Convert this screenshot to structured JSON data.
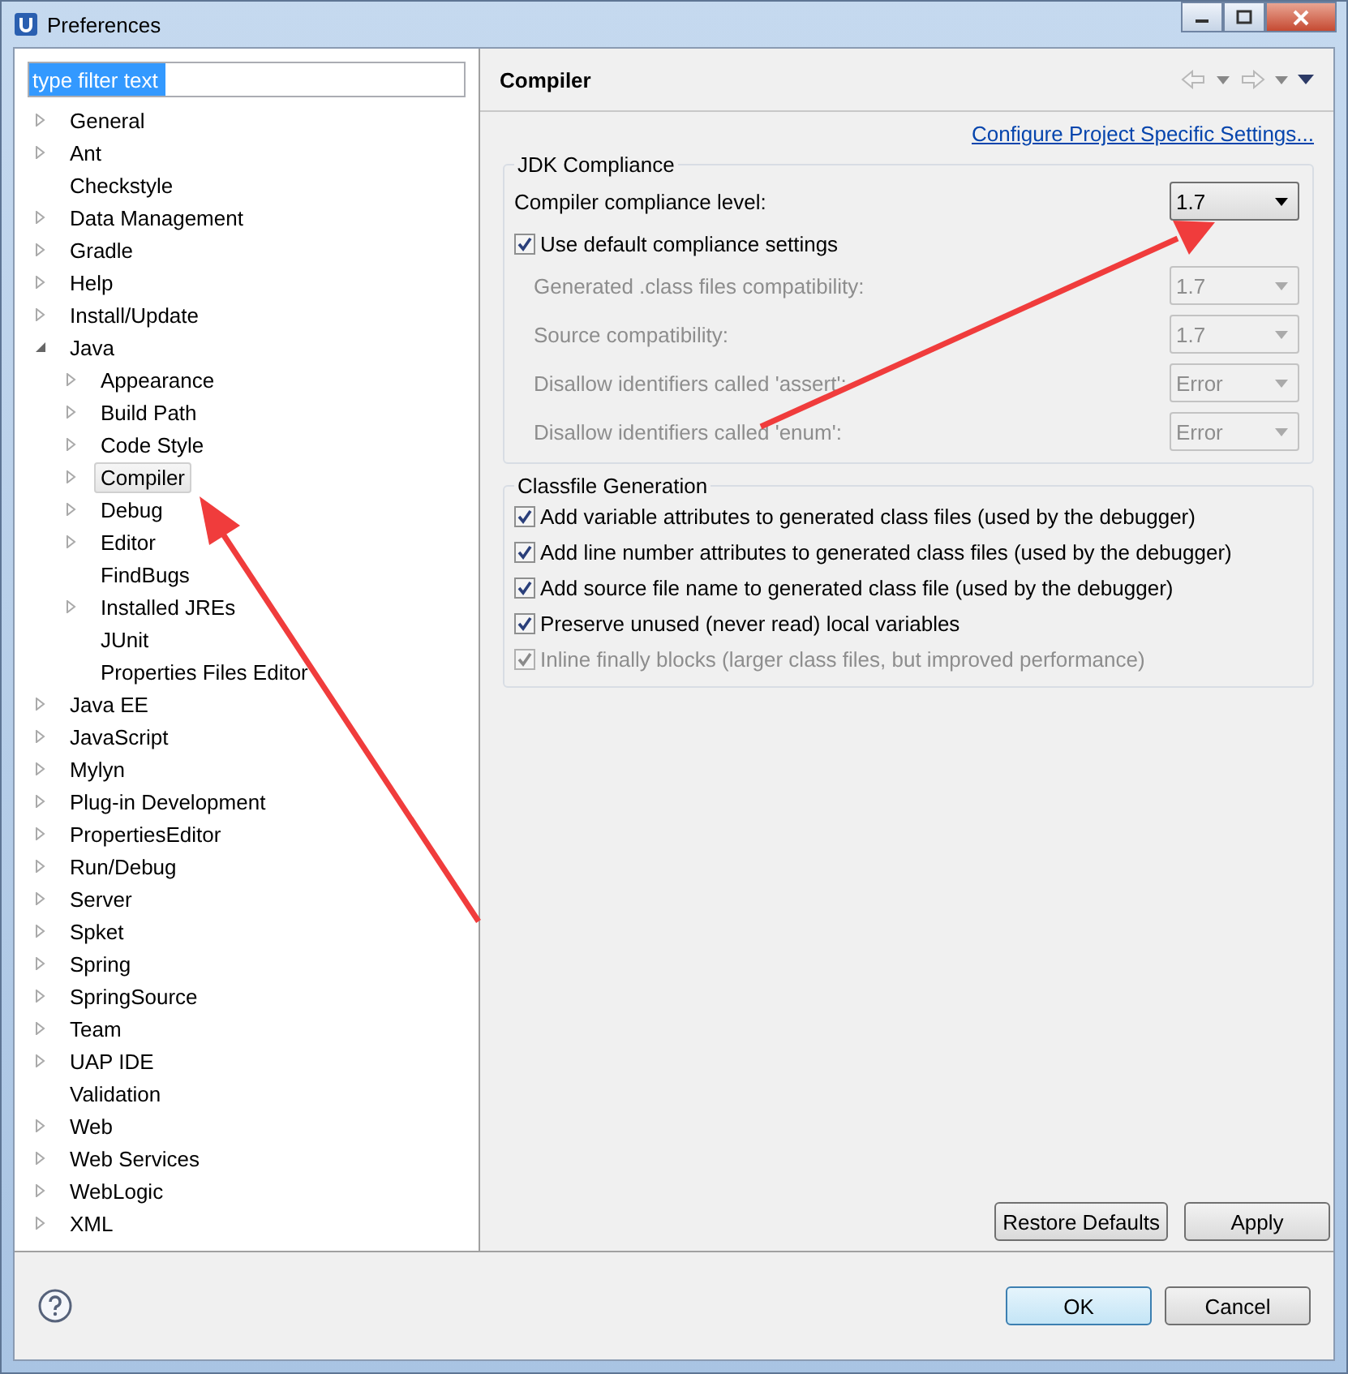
{
  "window": {
    "title": "Preferences"
  },
  "filter": {
    "value": "type filter text"
  },
  "tree": [
    {
      "label": "General",
      "kind": "branch",
      "expanded": false,
      "selected": false
    },
    {
      "label": "Ant",
      "kind": "branch",
      "expanded": false,
      "selected": false
    },
    {
      "label": "Checkstyle",
      "kind": "leaf",
      "selected": false
    },
    {
      "label": "Data Management",
      "kind": "branch",
      "expanded": false,
      "selected": false
    },
    {
      "label": "Gradle",
      "kind": "branch",
      "expanded": false,
      "selected": false
    },
    {
      "label": "Help",
      "kind": "branch",
      "expanded": false,
      "selected": false
    },
    {
      "label": "Install/Update",
      "kind": "branch",
      "expanded": false,
      "selected": false
    },
    {
      "label": "Java",
      "kind": "branch",
      "expanded": true,
      "selected": false,
      "children": [
        {
          "label": "Appearance",
          "kind": "branch",
          "expanded": false,
          "selected": false
        },
        {
          "label": "Build Path",
          "kind": "branch",
          "expanded": false,
          "selected": false
        },
        {
          "label": "Code Style",
          "kind": "branch",
          "expanded": false,
          "selected": false
        },
        {
          "label": "Compiler",
          "kind": "branch",
          "expanded": false,
          "selected": true
        },
        {
          "label": "Debug",
          "kind": "branch",
          "expanded": false,
          "selected": false
        },
        {
          "label": "Editor",
          "kind": "branch",
          "expanded": false,
          "selected": false
        },
        {
          "label": "FindBugs",
          "kind": "leaf",
          "selected": false
        },
        {
          "label": "Installed JREs",
          "kind": "branch",
          "expanded": false,
          "selected": false
        },
        {
          "label": "JUnit",
          "kind": "leaf",
          "selected": false
        },
        {
          "label": "Properties Files Editor",
          "kind": "leaf",
          "selected": false
        }
      ]
    },
    {
      "label": "Java EE",
      "kind": "branch",
      "expanded": false,
      "selected": false
    },
    {
      "label": "JavaScript",
      "kind": "branch",
      "expanded": false,
      "selected": false
    },
    {
      "label": "Mylyn",
      "kind": "branch",
      "expanded": false,
      "selected": false
    },
    {
      "label": "Plug-in Development",
      "kind": "branch",
      "expanded": false,
      "selected": false
    },
    {
      "label": "PropertiesEditor",
      "kind": "branch",
      "expanded": false,
      "selected": false
    },
    {
      "label": "Run/Debug",
      "kind": "branch",
      "expanded": false,
      "selected": false
    },
    {
      "label": "Server",
      "kind": "branch",
      "expanded": false,
      "selected": false
    },
    {
      "label": "Spket",
      "kind": "branch",
      "expanded": false,
      "selected": false
    },
    {
      "label": "Spring",
      "kind": "branch",
      "expanded": false,
      "selected": false
    },
    {
      "label": "SpringSource",
      "kind": "branch",
      "expanded": false,
      "selected": false
    },
    {
      "label": "Team",
      "kind": "branch",
      "expanded": false,
      "selected": false
    },
    {
      "label": "UAP IDE",
      "kind": "branch",
      "expanded": false,
      "selected": false
    },
    {
      "label": "Validation",
      "kind": "leaf",
      "selected": false
    },
    {
      "label": "Web",
      "kind": "branch",
      "expanded": false,
      "selected": false
    },
    {
      "label": "Web Services",
      "kind": "branch",
      "expanded": false,
      "selected": false
    },
    {
      "label": "WebLogic",
      "kind": "branch",
      "expanded": false,
      "selected": false
    },
    {
      "label": "XML",
      "kind": "branch",
      "expanded": false,
      "selected": false
    }
  ],
  "page": {
    "title": "Compiler",
    "link": "Configure Project Specific Settings...",
    "jdk": {
      "title": "JDK Compliance",
      "level_label": "Compiler compliance level:",
      "level_value": "1.7",
      "use_default": {
        "label": "Use default compliance settings",
        "checked": true
      },
      "settings": [
        {
          "label": "Generated .class files compatibility:",
          "value": "1.7",
          "disabled": true
        },
        {
          "label": "Source compatibility:",
          "value": "1.7",
          "disabled": true
        },
        {
          "label": "Disallow identifiers called 'assert':",
          "value": "Error",
          "disabled": true
        },
        {
          "label": "Disallow identifiers called 'enum':",
          "value": "Error",
          "disabled": true
        }
      ]
    },
    "classfile": {
      "title": "Classfile Generation",
      "options": [
        {
          "label": "Add variable attributes to generated class files (used by the debugger)",
          "checked": true,
          "disabled": false
        },
        {
          "label": "Add line number attributes to generated class files (used by the debugger)",
          "checked": true,
          "disabled": false
        },
        {
          "label": "Add source file name to generated class file (used by the debugger)",
          "checked": true,
          "disabled": false
        },
        {
          "label": "Preserve unused (never read) local variables",
          "checked": true,
          "disabled": false
        },
        {
          "label": "Inline finally blocks (larger class files, but improved performance)",
          "checked": true,
          "disabled": true
        }
      ]
    },
    "buttons": [
      "Restore Defaults",
      "Apply"
    ]
  },
  "dialog_buttons": [
    {
      "label": "OK",
      "default": true
    },
    {
      "label": "Cancel",
      "default": false
    }
  ]
}
